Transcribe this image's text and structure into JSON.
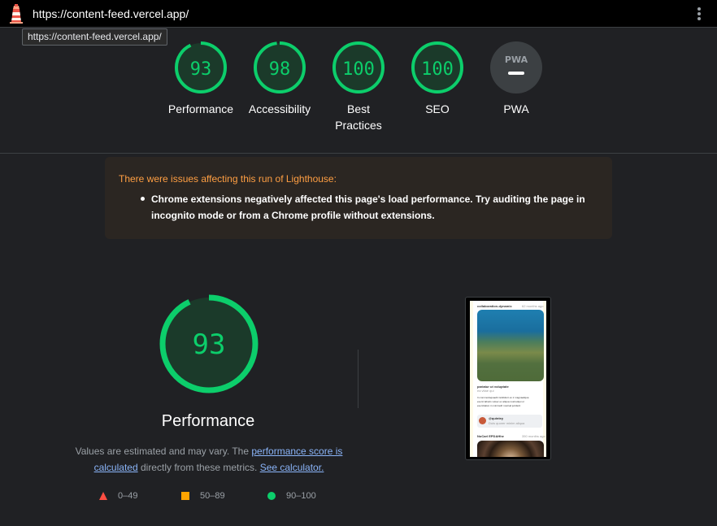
{
  "topbar": {
    "url": "https://content-feed.vercel.app/",
    "tooltip": "https://content-feed.vercel.app/"
  },
  "categories": [
    {
      "score": "93",
      "label": "Performance",
      "fraction": 0.93,
      "color": "#0cce6b"
    },
    {
      "score": "98",
      "label": "Accessibility",
      "fraction": 0.98,
      "color": "#0cce6b"
    },
    {
      "score": "100",
      "label": "Best Practices",
      "fraction": 1.0,
      "color": "#0cce6b"
    },
    {
      "score": "100",
      "label": "SEO",
      "fraction": 1.0,
      "color": "#0cce6b"
    },
    {
      "score": "",
      "label": "PWA",
      "badge": "PWA",
      "color": "#9aa0a6"
    }
  ],
  "warning": {
    "title": "There were issues affecting this run of Lighthouse:",
    "item": "Chrome extensions negatively affected this page's load performance. Try auditing the page in incognito mode or from a Chrome profile without extensions."
  },
  "performance": {
    "score": "93",
    "fraction": 0.93,
    "label": "Performance",
    "desc_prefix": "Values are estimated and may vary. The ",
    "desc_link1": "performance score is calculated",
    "desc_mid": " directly from these metrics. ",
    "desc_link2": "See calculator.",
    "legend": [
      {
        "shape": "triangle",
        "range": "0–49",
        "color": "#ff4e42"
      },
      {
        "shape": "square",
        "range": "50–89",
        "color": "#ffa400"
      },
      {
        "shape": "circle",
        "range": "90–100",
        "color": "#0cce6b"
      }
    ]
  },
  "thumbnail": {
    "user": "collaboration-dynamic",
    "time1": "62 months ago",
    "post_title": "pariatur ut voluptate",
    "post_sub": "ea vitae qui",
    "post_body_1": "In commodoquaelit incididunt ex ir magnaaliqua",
    "post_body_2": "exerci laboris voluer ex aliqua nostrudqui ul",
    "post_body_3": "exercitation in minimullr nostrud juridscit",
    "comment_user": "@quintey",
    "comment_text": "Duis quorer minim aliqua",
    "user2": "NoCarl EPDAHhe",
    "time2": "350 months ago"
  }
}
